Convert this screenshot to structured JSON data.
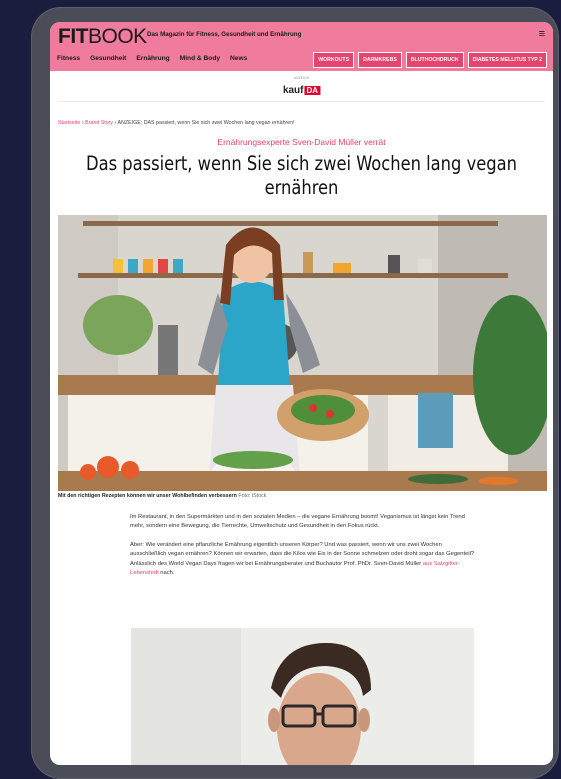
{
  "header": {
    "logo_bold": "FIT",
    "logo_rest": "BOOK",
    "tagline": "Das Magazin für Fitness, Gesundheit und Ernährung",
    "menu_glyph": "≡",
    "nav": [
      "Fitness",
      "Gesundheit",
      "Ernährung",
      "Mind & Body",
      "News"
    ],
    "pills": [
      "WORKOUTS",
      "DARMKREBS",
      "BLUTHOCHDRUCK",
      "DIABETES MELLITUS TYP 2"
    ]
  },
  "ad": {
    "label": "ANZEIGE",
    "brand": "kauf",
    "brand_badge": "DA"
  },
  "breadcrumb": {
    "home": "Startseite",
    "sep1": " › ",
    "section": "Brand Story",
    "sep2": " › ",
    "current": "ANZEIGE: DAS passiert, wenn Sie sich zwei Wochen lang vegan ernähren!"
  },
  "article": {
    "kicker": "Ernährungsexperte Sven-David Müller verrät",
    "headline": "Das passiert, wenn Sie sich zwei Wochen lang vegan ernähren",
    "caption": "Mit den richtigen Rezepten können wir unser Wohlbefinden verbessern",
    "caption_source": "Foto: iStock",
    "para1": "Im Restaurant, in den Supermärkten und in den sozialen Medien – die vegane Ernährung boomt! Veganismus ist längst kein Trend mehr, sondern eine Bewegung, die Tierrechte, Umweltschutz und Gesundheit in den Fokus rückt.",
    "para2_pre": "Aber: Wie verändert eine pflanzliche Ernährung eigentlich unseren Körper? Und was passiert, wenn wir uns zwei Wochen ausschließlich vegan ernähren? Können wir erwarten, dass die Kilos wie Eis in der Sonne schmelzen oder droht sogar das Gegenteil? Anlässlich des World Vegan Days fragen wir bei Ernährungsberater und Buchautor Prof. PhDr. Sven-David Müller ",
    "para2_link": "aus Salzgitter-Lebenstedt",
    "para2_post": " nach."
  },
  "colors": {
    "brand_pink": "#f07b9c",
    "accent": "#e4446d",
    "page_bg": "#1b1d3f",
    "device": "#4a4d58"
  }
}
